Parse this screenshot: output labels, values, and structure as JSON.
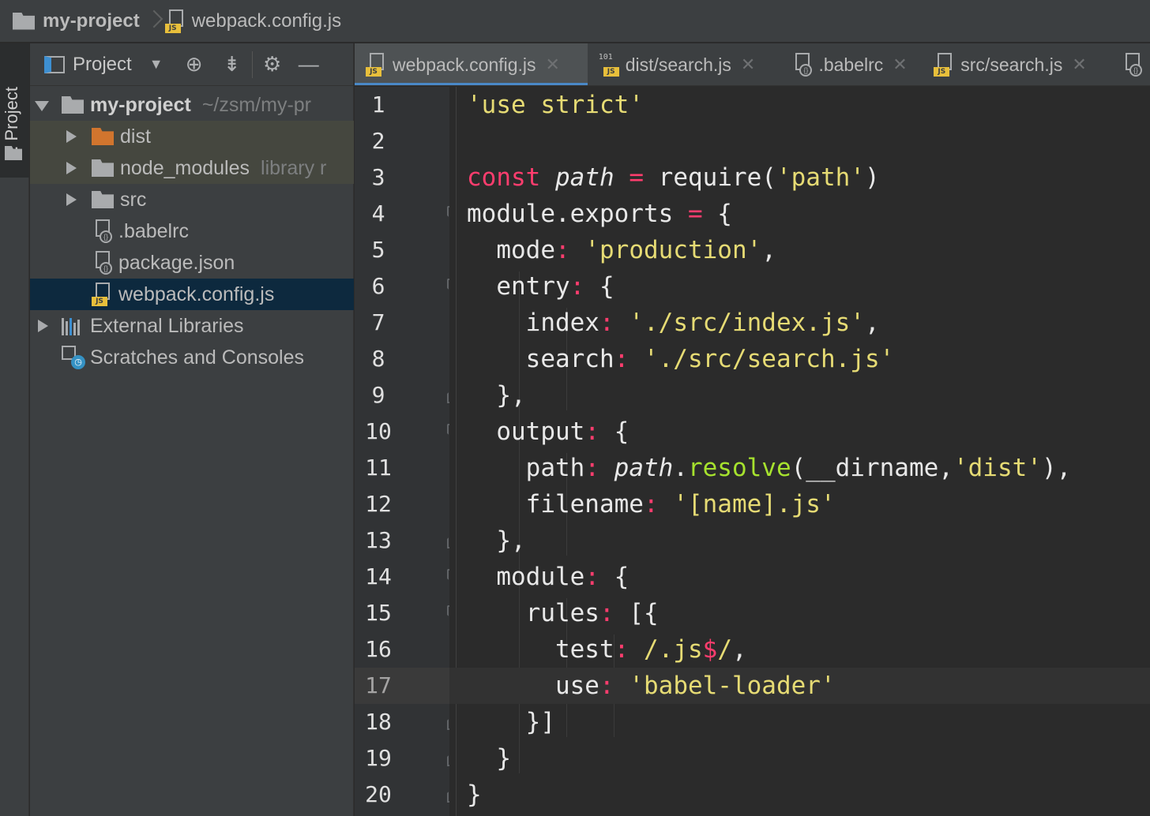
{
  "breadcrumb": {
    "project": "my-project",
    "file": "webpack.config.js"
  },
  "stripe": {
    "label": "1: Project"
  },
  "project_panel": {
    "title": "Project",
    "tree": [
      {
        "label": "my-project",
        "hint": "~/zsm/my-pr"
      },
      {
        "label": "dist",
        "hint": ""
      },
      {
        "label": "node_modules",
        "hint": "library r"
      },
      {
        "label": "src",
        "hint": ""
      },
      {
        "label": ".babelrc",
        "hint": ""
      },
      {
        "label": "package.json",
        "hint": ""
      },
      {
        "label": "webpack.config.js",
        "hint": ""
      },
      {
        "label": "External Libraries",
        "hint": ""
      },
      {
        "label": "Scratches and Consoles",
        "hint": ""
      }
    ]
  },
  "tabs": [
    {
      "label": "webpack.config.js",
      "active": true
    },
    {
      "label": "dist/search.js",
      "active": false
    },
    {
      "label": ".babelrc",
      "active": false
    },
    {
      "label": "src/search.js",
      "active": false
    }
  ],
  "icons": {
    "js_badge": "JS",
    "binary_badge": "101",
    "config_badge": "{}",
    "clock_badge": "◷"
  },
  "editor": {
    "current_line": 17,
    "line_numbers": [
      "1",
      "2",
      "3",
      "4",
      "5",
      "6",
      "7",
      "8",
      "9",
      "10",
      "11",
      "12",
      "13",
      "14",
      "15",
      "16",
      "17",
      "18",
      "19",
      "20"
    ],
    "lines": [
      [
        {
          "t": "'use strict'",
          "c": "str"
        }
      ],
      [],
      [
        {
          "t": "const",
          "c": "kw"
        },
        {
          "t": " "
        },
        {
          "t": "path",
          "c": "it"
        },
        {
          "t": " "
        },
        {
          "t": "=",
          "c": "op"
        },
        {
          "t": " require("
        },
        {
          "t": "'path'",
          "c": "str"
        },
        {
          "t": ")"
        }
      ],
      [
        {
          "t": "module.exports "
        },
        {
          "t": "=",
          "c": "op"
        },
        {
          "t": " {"
        }
      ],
      [
        {
          "t": "   mode"
        },
        {
          "t": ":",
          "c": "op"
        },
        {
          "t": " "
        },
        {
          "t": "'production'",
          "c": "str"
        },
        {
          "t": ","
        }
      ],
      [
        {
          "t": "   entry"
        },
        {
          "t": ":",
          "c": "op"
        },
        {
          "t": " {"
        }
      ],
      [
        {
          "t": "      index"
        },
        {
          "t": ":",
          "c": "op"
        },
        {
          "t": " "
        },
        {
          "t": "'./src/index.js'",
          "c": "str"
        },
        {
          "t": ","
        }
      ],
      [
        {
          "t": "      search"
        },
        {
          "t": ":",
          "c": "op"
        },
        {
          "t": " "
        },
        {
          "t": "'./src/search.js'",
          "c": "str"
        }
      ],
      [
        {
          "t": "   },"
        }
      ],
      [
        {
          "t": "   output"
        },
        {
          "t": ":",
          "c": "op"
        },
        {
          "t": " {"
        }
      ],
      [
        {
          "t": "      path"
        },
        {
          "t": ":",
          "c": "op"
        },
        {
          "t": " "
        },
        {
          "t": "path",
          "c": "it"
        },
        {
          "t": "."
        },
        {
          "t": "resolve",
          "c": "fn"
        },
        {
          "t": "(__dirname,"
        },
        {
          "t": "'dist'",
          "c": "str"
        },
        {
          "t": "),"
        }
      ],
      [
        {
          "t": "      filename"
        },
        {
          "t": ":",
          "c": "op"
        },
        {
          "t": " "
        },
        {
          "t": "'[name].js'",
          "c": "str"
        }
      ],
      [
        {
          "t": "   },"
        }
      ],
      [
        {
          "t": "   module"
        },
        {
          "t": ":",
          "c": "op"
        },
        {
          "t": " {"
        }
      ],
      [
        {
          "t": "      rules"
        },
        {
          "t": ":",
          "c": "op"
        },
        {
          "t": " [{"
        }
      ],
      [
        {
          "t": "         test"
        },
        {
          "t": ":",
          "c": "op"
        },
        {
          "t": " "
        },
        {
          "t": "/.js",
          "c": "str"
        },
        {
          "t": "$",
          "c": "kw"
        },
        {
          "t": "/",
          "c": "str"
        },
        {
          "t": ","
        }
      ],
      [
        {
          "t": "         use"
        },
        {
          "t": ":",
          "c": "op"
        },
        {
          "t": " "
        },
        {
          "t": "'babel-loader'",
          "c": "str"
        }
      ],
      [
        {
          "t": "      }]"
        }
      ],
      [
        {
          "t": "   }"
        }
      ],
      [
        {
          "t": "}"
        }
      ]
    ]
  }
}
